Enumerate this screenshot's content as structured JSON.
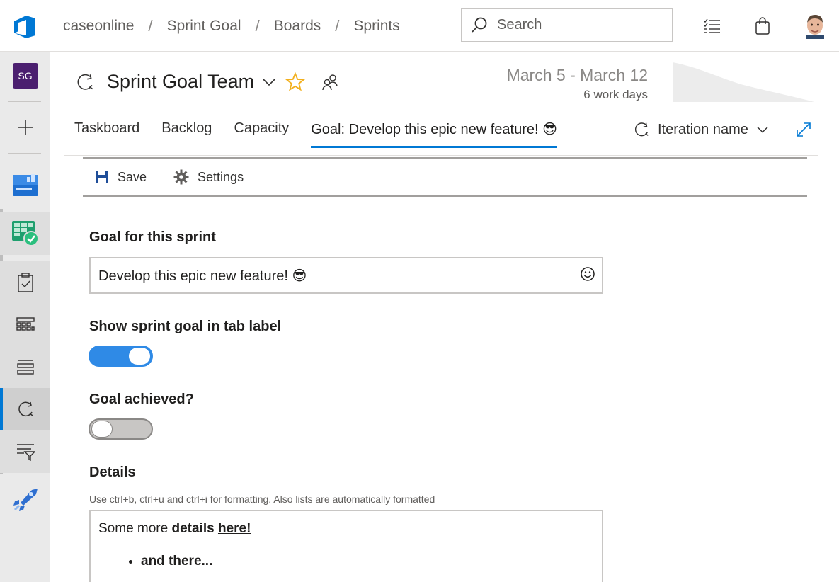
{
  "breadcrumbs": [
    "caseonline",
    "Sprint Goal",
    "Boards",
    "Sprints"
  ],
  "breadcrumb_separator": "/",
  "search": {
    "placeholder": "Search"
  },
  "rail": {
    "project_initials": "SG"
  },
  "header": {
    "team_name": "Sprint Goal Team",
    "date_range": "March 5 - March 12",
    "work_days": "6 work days"
  },
  "tabs": [
    {
      "label": "Taskboard"
    },
    {
      "label": "Backlog"
    },
    {
      "label": "Capacity"
    },
    {
      "label": "Goal: Develop this epic new feature! 😎"
    }
  ],
  "iteration": {
    "label": "Iteration name"
  },
  "toolbar": {
    "save_label": "Save",
    "settings_label": "Settings"
  },
  "form": {
    "goal_label": "Goal for this sprint",
    "goal_value": "Develop this epic new feature!  😎",
    "show_in_tab_label": "Show sprint goal in tab label",
    "show_in_tab_on": true,
    "achieved_label": "Goal achieved?",
    "achieved_on": false,
    "details_label": "Details",
    "details_hint": "Use ctrl+b, ctrl+u and ctrl+i for formatting. Also lists are automatically formatted",
    "details_prefix": "Some more ",
    "details_bold": "details",
    "details_space": " ",
    "details_link": "here!",
    "details_list_item": "and there..."
  },
  "colors": {
    "accent": "#0078d4",
    "toggle_on": "#2f8ae6",
    "project_tile": "#4b1f6f"
  }
}
